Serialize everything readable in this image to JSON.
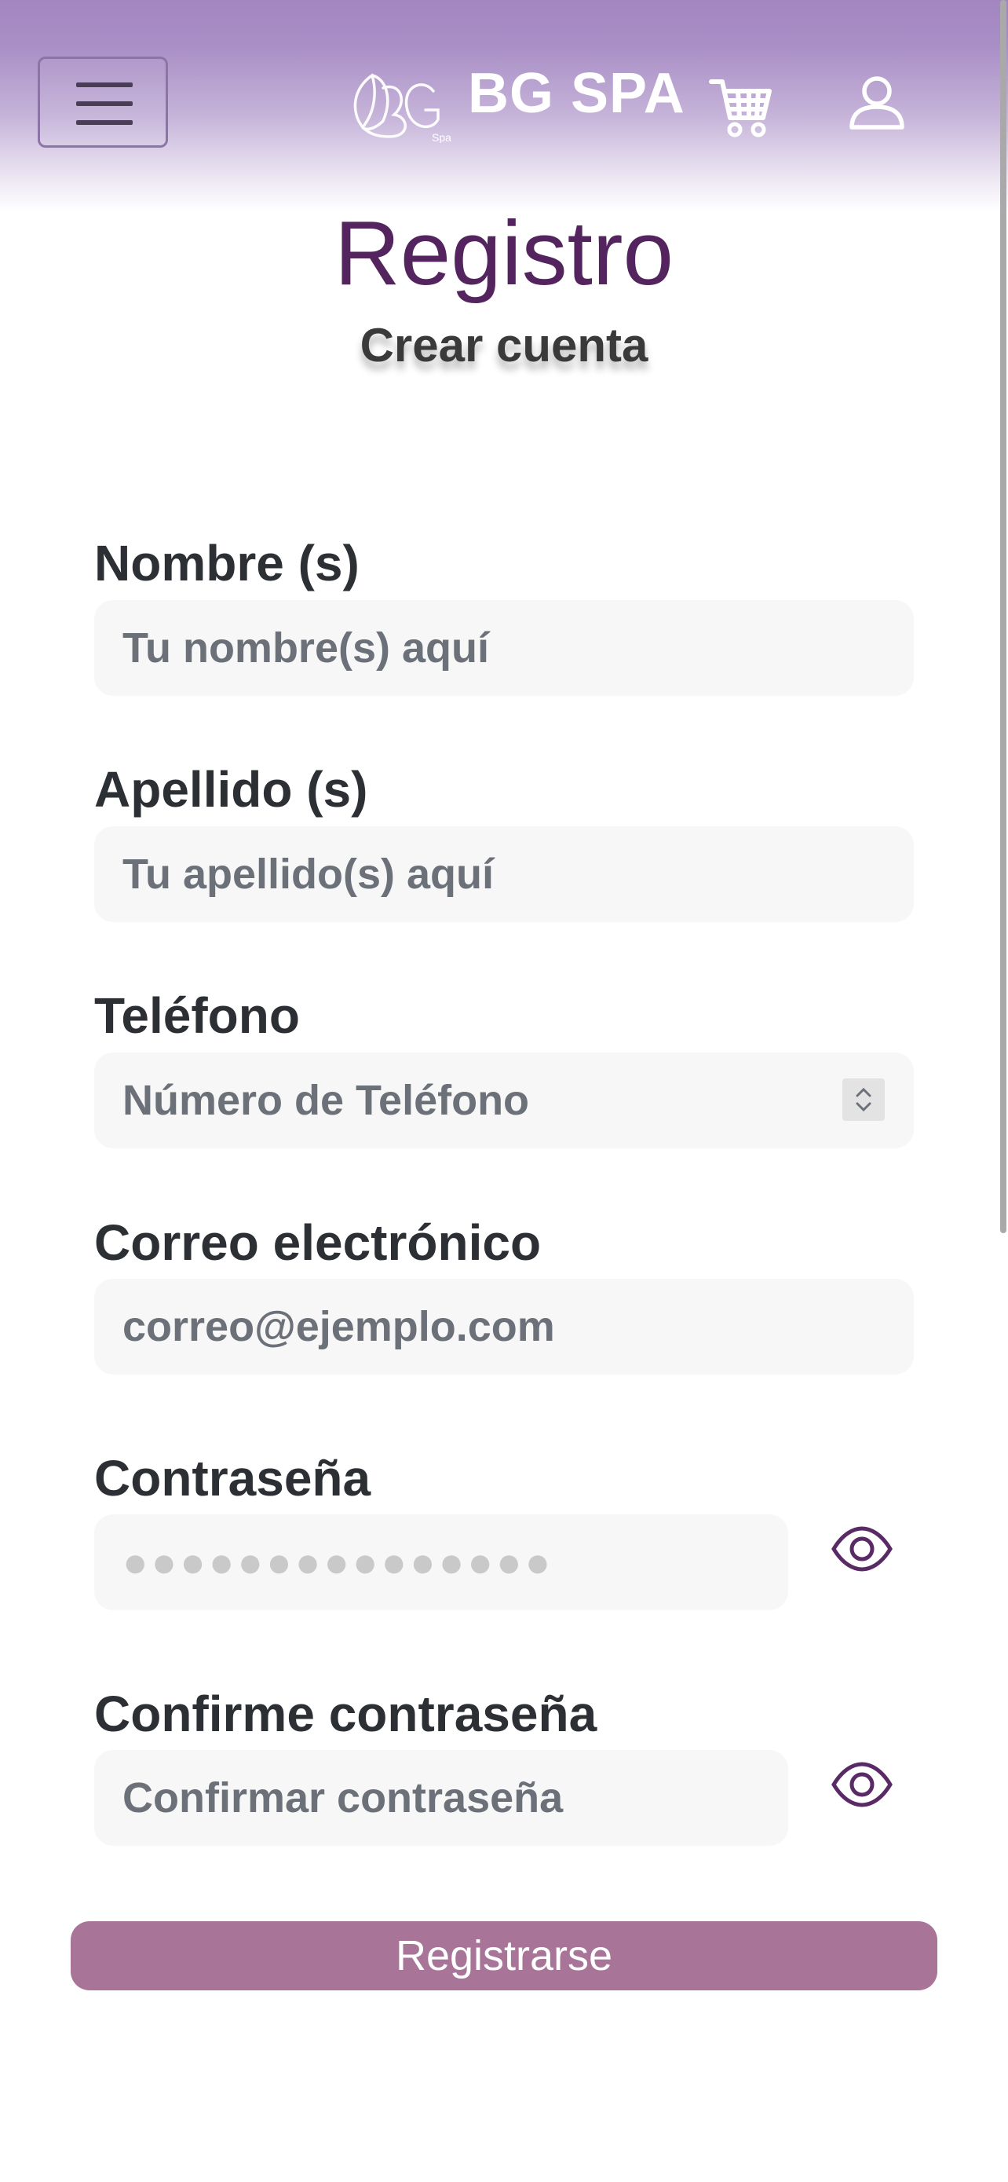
{
  "header": {
    "brand": "BG SPA",
    "colors": {
      "gradient_top": "#a385bf",
      "accent": "#54245f",
      "button": "#a87598"
    },
    "icons": [
      "hamburger-menu-icon",
      "bg-spa-logo",
      "cart-icon",
      "user-icon"
    ]
  },
  "page": {
    "title": "Registro",
    "subtitle": "Crear cuenta"
  },
  "form": {
    "nombre": {
      "label": "Nombre (s)",
      "placeholder": "Tu nombre(s) aquí"
    },
    "apellido": {
      "label": "Apellido (s)",
      "placeholder": "Tu apellido(s) aquí"
    },
    "telefono": {
      "label": "Teléfono",
      "placeholder": "Número de Teléfono"
    },
    "correo": {
      "label": "Correo electrónico",
      "placeholder": "correo@ejemplo.com"
    },
    "contrasena": {
      "label": "Contraseña",
      "placeholder": "●●●●●●●●●●●●●●●"
    },
    "confirmar": {
      "label": "Confirme contraseña",
      "placeholder": "Confirmar contraseña"
    },
    "submit_label": "Registrarse"
  }
}
